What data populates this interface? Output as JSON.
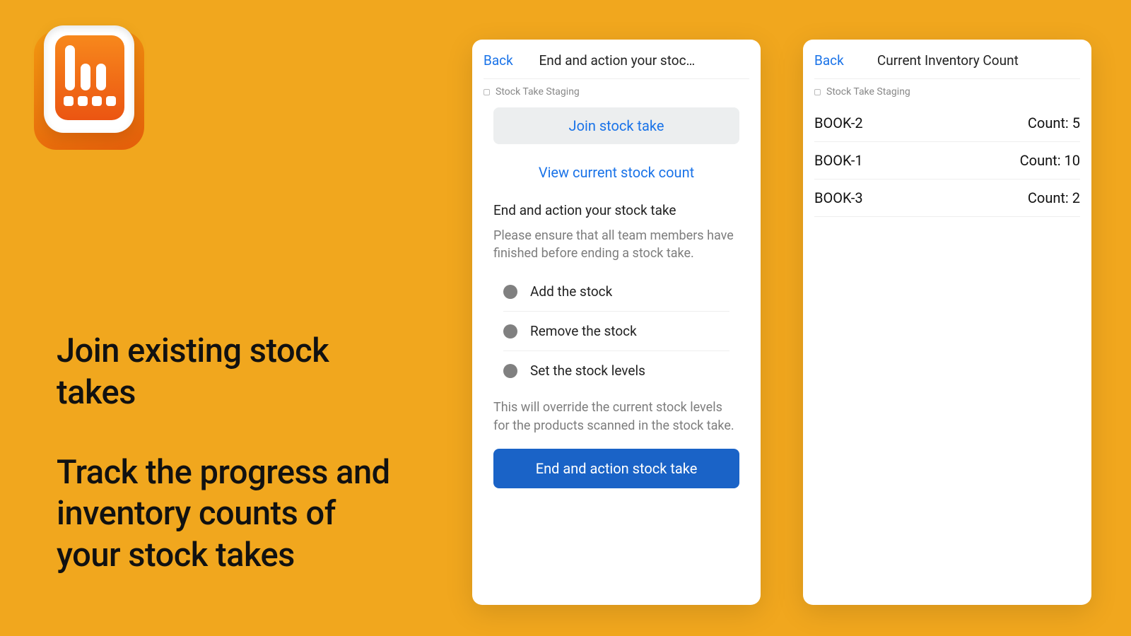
{
  "hero": {
    "line1": "Join existing stock takes",
    "line2": "Track the progress and inventory counts of your stock takes"
  },
  "colors": {
    "accent": "#1a73e8",
    "primaryBtn": "#1a63c7",
    "bg": "#f1a71e"
  },
  "left": {
    "back": "Back",
    "title": "End and action your stoc…",
    "breadcrumb": "Stock Take Staging",
    "joinButton": "Join stock take",
    "viewLink": "View current stock count",
    "sectionTitle": "End and action your stock take",
    "sectionDesc": "Please ensure that all team members have finished before ending a stock take.",
    "options": [
      {
        "label": "Add the stock"
      },
      {
        "label": "Remove the stock"
      },
      {
        "label": "Set the stock levels"
      }
    ],
    "note": "This will override the current stock levels for the products scanned in the stock take.",
    "primaryButton": "End and action stock take"
  },
  "right": {
    "back": "Back",
    "title": "Current Inventory Count",
    "breadcrumb": "Stock Take Staging",
    "countLabel": "Count:",
    "items": [
      {
        "name": "BOOK-2",
        "count": 5
      },
      {
        "name": "BOOK-1",
        "count": 10
      },
      {
        "name": "BOOK-3",
        "count": 2
      }
    ]
  }
}
